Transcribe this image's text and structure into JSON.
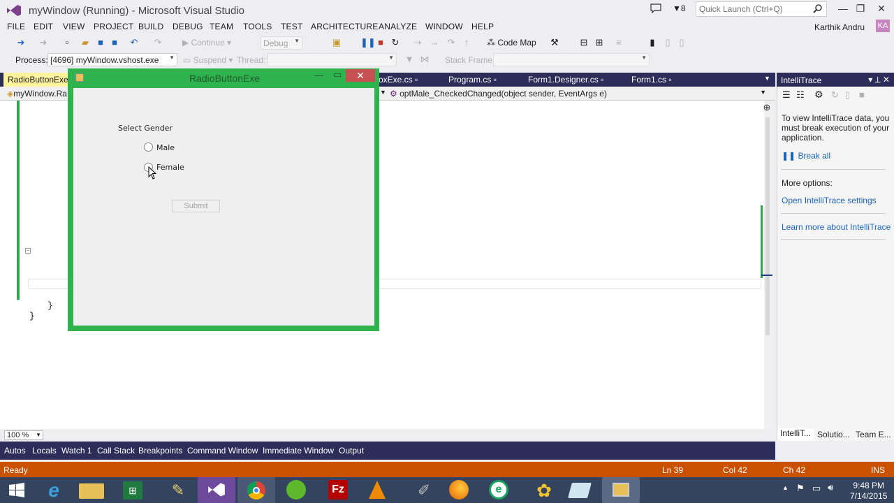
{
  "titlebar": {
    "title": "myWindow (Running) - Microsoft Visual Studio",
    "filter_count": "8",
    "quick_launch_placeholder": "Quick Launch (Ctrl+Q)"
  },
  "menu": [
    "FILE",
    "EDIT",
    "VIEW",
    "PROJECT",
    "BUILD",
    "DEBUG",
    "TEAM",
    "TOOLS",
    "TEST",
    "ARCHITECTURE",
    "ANALYZE",
    "WINDOW",
    "HELP"
  ],
  "user": {
    "name": "Karthik Andru",
    "initials": "KA"
  },
  "toolbar": {
    "continue": "Continue",
    "config": "Debug",
    "code_map": "Code Map"
  },
  "debug_toolbar": {
    "process_label": "Process:",
    "process_value": "[4696] myWindow.vshost.exe",
    "suspend": "Suspend",
    "thread_label": "Thread:",
    "stack_label": "Stack Frame:"
  },
  "tabs": [
    {
      "label": "RadioButtonExe.cs"
    },
    {
      "label": "oxExe.cs"
    },
    {
      "label": "Program.cs"
    },
    {
      "label": "Form1.Designer.cs"
    },
    {
      "label": "Form1.cs"
    }
  ],
  "navbar": {
    "left": "myWindow.Ra",
    "right": "optMale_CheckedChanged(object sender, EventArgs e)"
  },
  "code": {
    "brace1": "}",
    "brace2": "}"
  },
  "zoom": "100 %",
  "intellitrace": {
    "title": "IntelliTrace",
    "message": "To view IntelliTrace data, you must break execution of your application.",
    "break_all": "Break all",
    "more_options": "More options:",
    "open_settings": "Open IntelliTrace settings",
    "learn_more": "Learn more about IntelliTrace",
    "tabs": [
      "IntelliT...",
      "Solutio...",
      "Team E..."
    ]
  },
  "bottom_tabs": [
    "Autos",
    "Locals",
    "Watch 1",
    "Call Stack",
    "Breakpoints",
    "Command Window",
    "Immediate Window",
    "Output"
  ],
  "status": {
    "ready": "Ready",
    "ln": "Ln 39",
    "col": "Col 42",
    "ch": "Ch 42",
    "ins": "INS"
  },
  "form": {
    "title": "RadioButtonExe",
    "group_label": "Select Gender",
    "option_male": "Male",
    "option_female": "Female",
    "submit": "Submit"
  },
  "clock": {
    "time": "9:48 PM",
    "date": "7/14/2015"
  },
  "colors": {
    "accent": "#2d2d5a",
    "status": "#ca5100",
    "form_border": "#2fb34f",
    "tab_active": "#fff29d",
    "link": "#1b63b8"
  }
}
